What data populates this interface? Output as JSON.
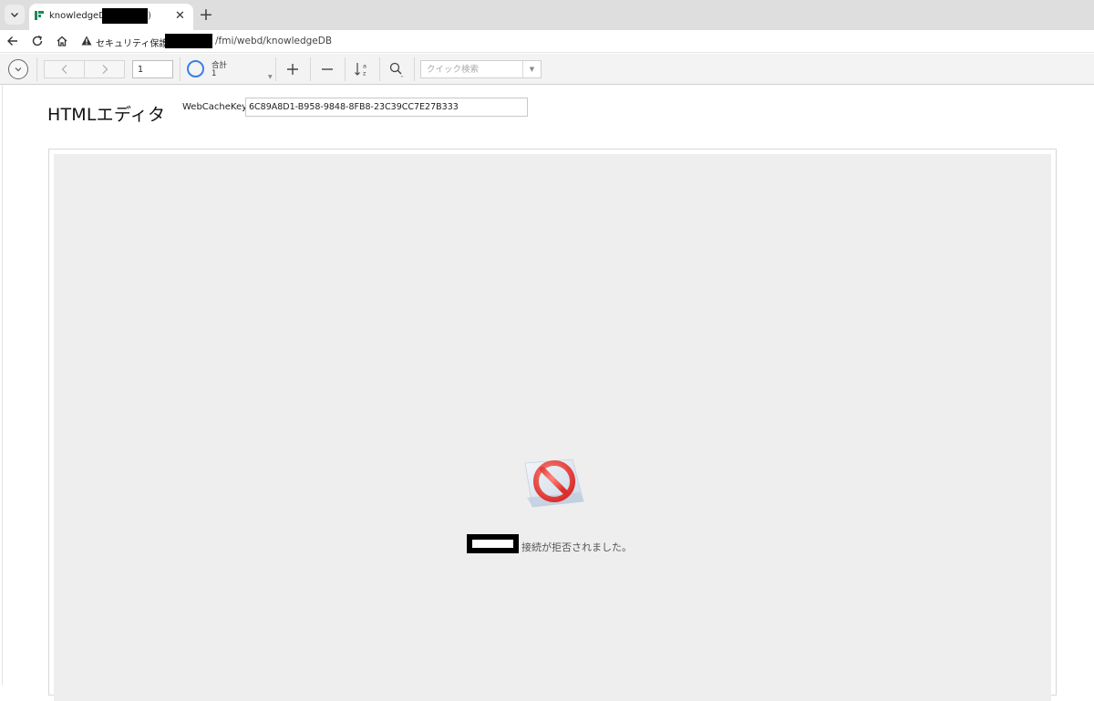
{
  "browser": {
    "tab": {
      "title": "knowledgeDB",
      "redacted_suffix": ")"
    },
    "address": {
      "security_label": "セキュリティ保護なし",
      "url_path": "/fmi/webd/knowledgeDB"
    }
  },
  "toolbar": {
    "record_number": "1",
    "total_label": "合計",
    "total_value": "1",
    "search_placeholder": "クイック検索",
    "sort_az_top": "a",
    "sort_az_bottom": "z"
  },
  "page": {
    "title": "HTMLエディタ",
    "webcachekey_label": "WebCacheKey",
    "webcachekey_value": "6C89A8D1-B958-9848-8FB8-23C39CC7E27B333"
  },
  "webviewer": {
    "error_message": "接続が拒否されました。"
  },
  "colors": {
    "accent_blue": "#3c7ee6",
    "error_red": "#e84b4b",
    "viewer_bg": "#eeeeee"
  }
}
